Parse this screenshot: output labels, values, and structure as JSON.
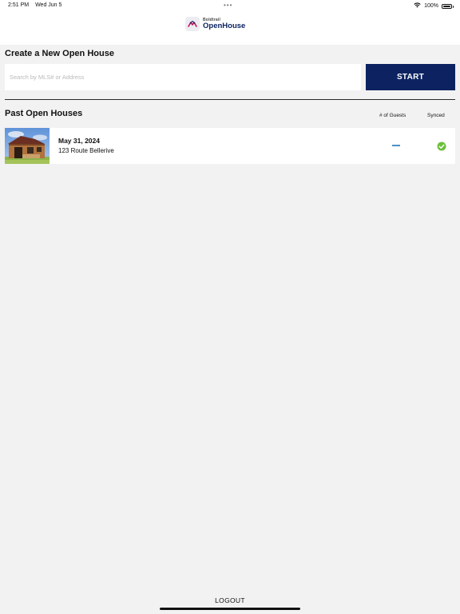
{
  "status_bar": {
    "time": "2:51 PM",
    "date": "Wed Jun 5",
    "dots": "•••",
    "battery": "100%",
    "wifi_icon": "wifi-icon",
    "battery_icon": "battery-icon"
  },
  "header": {
    "brand": "Boldtrail",
    "product": "OpenHouse",
    "logo_icon": "boldtrail-logo-icon"
  },
  "create": {
    "title": "Create a New Open House",
    "search_placeholder": "Search by MLS# or Address",
    "search_value": "",
    "start_label": "START"
  },
  "past": {
    "title": "Past Open Houses",
    "columns": [
      "# of Guests",
      "Synced"
    ],
    "rows": [
      {
        "date": "May 31, 2024",
        "address": "123 Route Bellerive",
        "guests": "—",
        "synced": true,
        "thumbnail": "barn-house-photo"
      }
    ]
  },
  "footer": {
    "logout_label": "LOGOUT"
  },
  "colors": {
    "accent_navy": "#0d2361",
    "synced_green": "#6cbf3a",
    "dash_blue": "#4a90c8",
    "logo_magenta": "#c2185b"
  }
}
